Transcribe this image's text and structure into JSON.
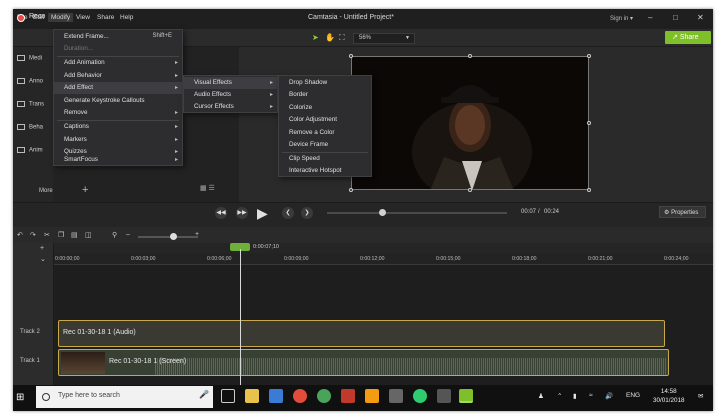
{
  "window": {
    "title": "Camtasia - Untitled Project*",
    "signin": "Sign in ▾"
  },
  "menubar": [
    "File",
    "Edit",
    "Modify",
    "View",
    "Share",
    "Help"
  ],
  "toolbar": {
    "record_label": "Reco",
    "zoom": "56%",
    "share_label": "Share"
  },
  "left_rail": [
    {
      "label": "Medi",
      "icon": "media-icon"
    },
    {
      "label": "Anno",
      "icon": "annotation-icon"
    },
    {
      "label": "Trans",
      "icon": "transition-icon"
    },
    {
      "label": "Beha",
      "icon": "behavior-icon"
    },
    {
      "label": "Anim",
      "icon": "animation-icon"
    }
  ],
  "more_label": "More",
  "modify_menu": [
    {
      "label": "Extend Frame...",
      "shortcut": "Shift+E",
      "arrow": false,
      "disabled": false
    },
    {
      "label": "Duration...",
      "shortcut": "",
      "arrow": false,
      "disabled": true
    },
    {
      "label": "Add Animation",
      "shortcut": "",
      "arrow": true,
      "disabled": false
    },
    {
      "label": "Add Behavior",
      "shortcut": "",
      "arrow": true,
      "disabled": false
    },
    {
      "label": "Add Effect",
      "shortcut": "",
      "arrow": true,
      "disabled": false,
      "highlight": true
    },
    {
      "label": "Generate Keystroke Callouts",
      "shortcut": "",
      "arrow": false,
      "disabled": false
    },
    {
      "label": "Remove",
      "shortcut": "",
      "arrow": true,
      "disabled": false
    },
    {
      "label": "Captions",
      "shortcut": "",
      "arrow": true,
      "disabled": false
    },
    {
      "label": "Markers",
      "shortcut": "",
      "arrow": true,
      "disabled": false
    },
    {
      "label": "Quizzes",
      "shortcut": "",
      "arrow": true,
      "disabled": false
    },
    {
      "label": "SmartFocus",
      "shortcut": "",
      "arrow": true,
      "disabled": false
    }
  ],
  "effect_menu": [
    {
      "label": "Visual Effects",
      "highlight": true
    },
    {
      "label": "Audio Effects",
      "highlight": false
    },
    {
      "label": "Cursor Effects",
      "highlight": false
    }
  ],
  "visual_effects_menu": [
    "Drop Shadow",
    "Border",
    "Colorize",
    "Color Adjustment",
    "Remove a Color",
    "Device Frame",
    "Clip Speed",
    "Interactive Hotspot"
  ],
  "playback": {
    "current_time": "00:07",
    "separator": "/",
    "total_time": "00:24",
    "progress": 0.29,
    "properties_label": "Properties"
  },
  "timeline": {
    "playhead_time": "0:00:07;10",
    "ruler": [
      "0:00:00;00",
      "0:00:03;00",
      "0:00:06;00",
      "0:00:09;00",
      "0:00:12;00",
      "0:00:15;00",
      "0:00:18;00",
      "0:00:21;00",
      "0:00:24;00"
    ],
    "tracks": [
      {
        "name": "Track 2",
        "clip": "Rec 01-30-18 1 (Audio)"
      },
      {
        "name": "Track 1",
        "clip": "Rec 01-30-18 1 (Screen)"
      }
    ]
  },
  "taskbar": {
    "search_placeholder": "Type here to search",
    "language": "ENG",
    "time": "14:58",
    "date": "30/01/2018"
  },
  "colors": {
    "accent_green": "#7fbf2a",
    "clip_border": "#c9a84a",
    "record_red": "#e84a4a"
  }
}
